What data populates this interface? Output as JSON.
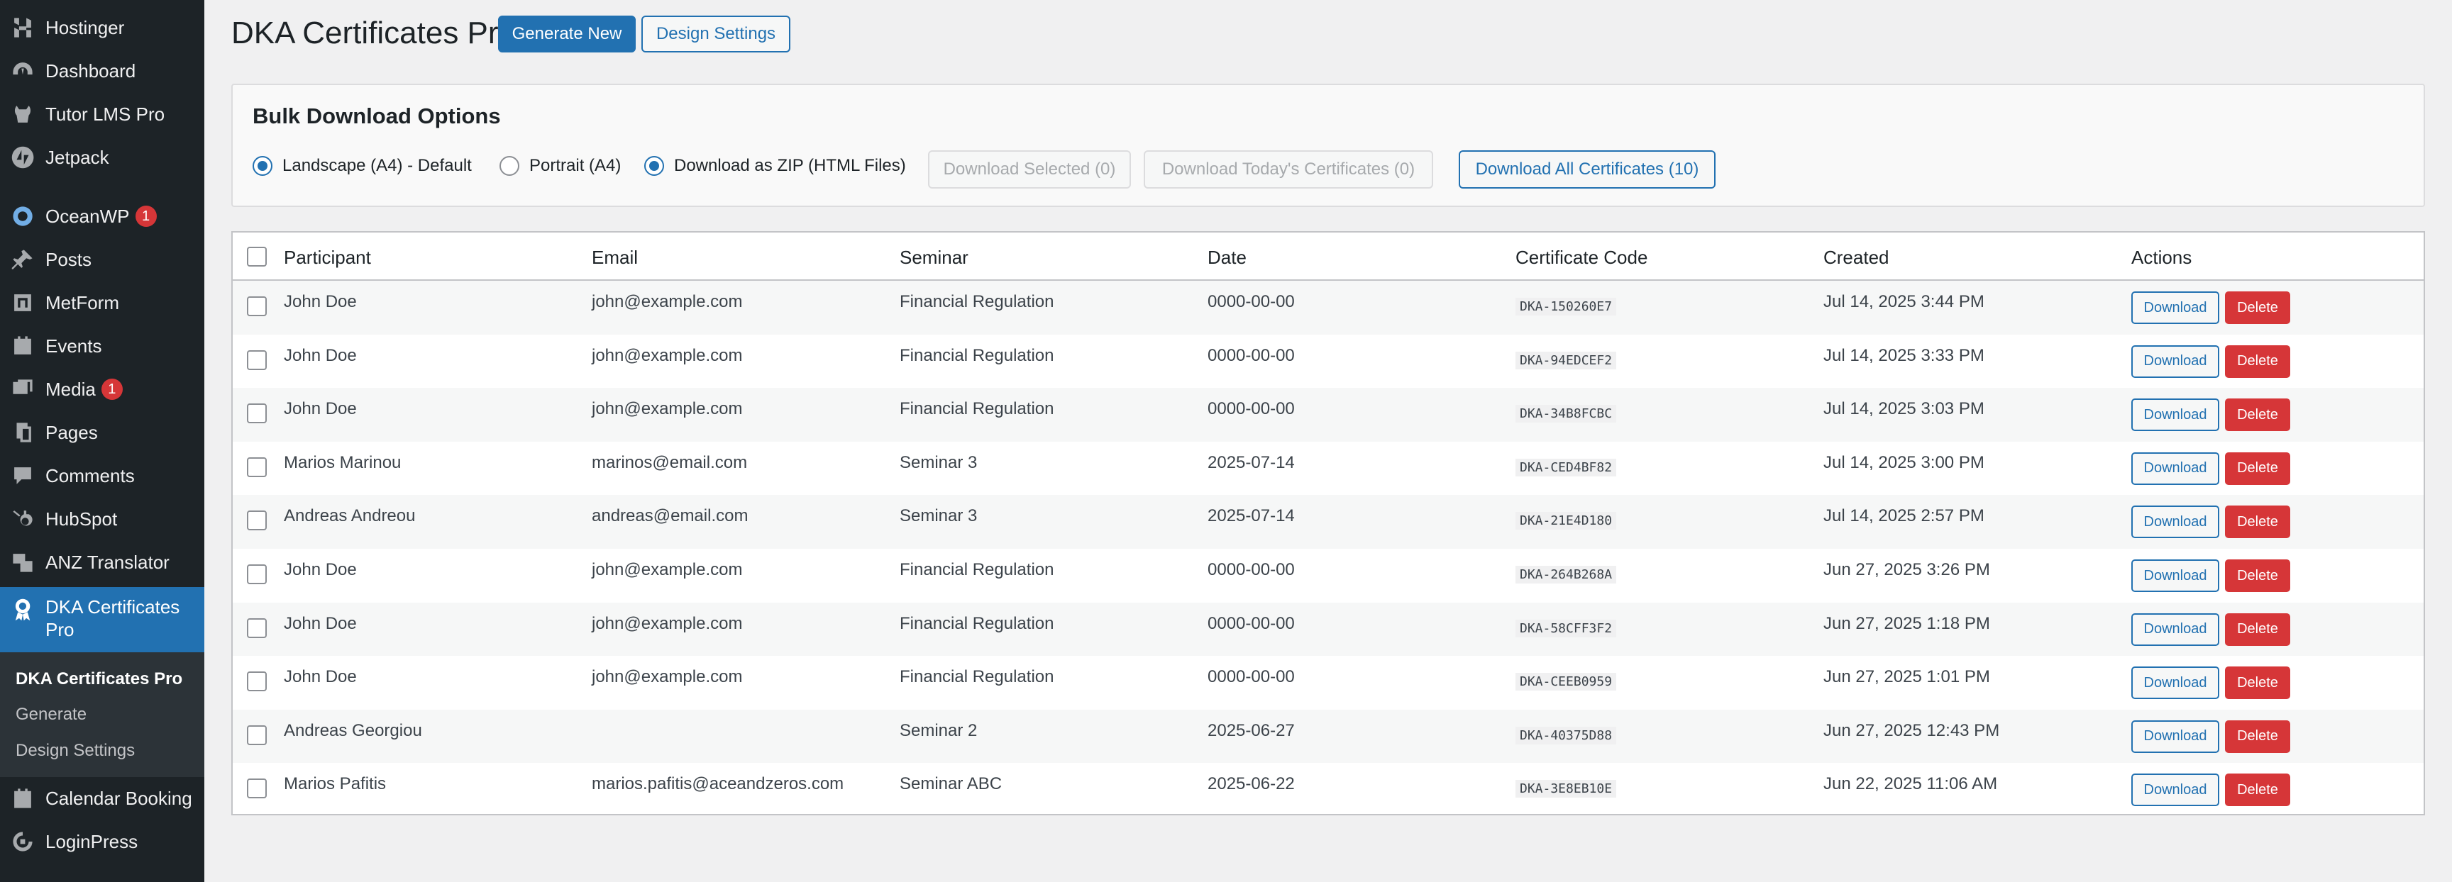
{
  "sidebar": {
    "items": [
      {
        "label": "Hostinger",
        "icon": "hostinger-icon"
      },
      {
        "label": "Dashboard",
        "icon": "dashboard-icon"
      },
      {
        "label": "Tutor LMS Pro",
        "icon": "tutor-icon"
      },
      {
        "label": "Jetpack",
        "icon": "jetpack-icon"
      },
      {
        "label": "OceanWP",
        "icon": "oceanwp-icon",
        "badge": "1"
      },
      {
        "label": "Posts",
        "icon": "pin-icon"
      },
      {
        "label": "MetForm",
        "icon": "metform-icon"
      },
      {
        "label": "Events",
        "icon": "events-icon"
      },
      {
        "label": "Media",
        "icon": "media-icon",
        "badge": "1"
      },
      {
        "label": "Pages",
        "icon": "pages-icon"
      },
      {
        "label": "Comments",
        "icon": "comments-icon"
      },
      {
        "label": "HubSpot",
        "icon": "hubspot-icon"
      },
      {
        "label": "ANZ Translator",
        "icon": "translator-icon"
      },
      {
        "label": "DKA Certificates Pro",
        "icon": "award-icon"
      },
      {
        "label": "Calendar Booking",
        "icon": "calendar-icon"
      },
      {
        "label": "LoginPress",
        "icon": "loginpress-icon"
      }
    ],
    "submenu": [
      "DKA Certificates Pro",
      "Generate",
      "Design Settings"
    ]
  },
  "header": {
    "title": "DKA Certificates Pro",
    "generate_label": "Generate New",
    "design_label": "Design Settings"
  },
  "bulk": {
    "title": "Bulk Download Options",
    "options": [
      "Landscape (A4) - Default",
      "Portrait (A4)",
      "Download as ZIP (HTML Files)"
    ],
    "selected_label": "Download Selected (0)",
    "today_label": "Download Today's Certificates (0)",
    "all_label": "Download All Certificates (10)"
  },
  "table": {
    "columns": [
      "Participant",
      "Email",
      "Seminar",
      "Date",
      "Certificate Code",
      "Created",
      "Actions"
    ],
    "download_label": "Download",
    "delete_label": "Delete",
    "rows": [
      {
        "participant": "John Doe",
        "email": "john@example.com",
        "seminar": "Financial Regulation",
        "date": "0000-00-00",
        "code": "DKA-150260E7",
        "created": "Jul 14, 2025 3:44 PM"
      },
      {
        "participant": "John Doe",
        "email": "john@example.com",
        "seminar": "Financial Regulation",
        "date": "0000-00-00",
        "code": "DKA-94EDCEF2",
        "created": "Jul 14, 2025 3:33 PM"
      },
      {
        "participant": "John Doe",
        "email": "john@example.com",
        "seminar": "Financial Regulation",
        "date": "0000-00-00",
        "code": "DKA-34B8FCBC",
        "created": "Jul 14, 2025 3:03 PM"
      },
      {
        "participant": "Marios Marinou",
        "email": "marinos@email.com",
        "seminar": "Seminar 3",
        "date": "2025-07-14",
        "code": "DKA-CED4BF82",
        "created": "Jul 14, 2025 3:00 PM"
      },
      {
        "participant": "Andreas Andreou",
        "email": "andreas@email.com",
        "seminar": "Seminar 3",
        "date": "2025-07-14",
        "code": "DKA-21E4D180",
        "created": "Jul 14, 2025 2:57 PM"
      },
      {
        "participant": "John Doe",
        "email": "john@example.com",
        "seminar": "Financial Regulation",
        "date": "0000-00-00",
        "code": "DKA-264B268A",
        "created": "Jun 27, 2025 3:26 PM"
      },
      {
        "participant": "John Doe",
        "email": "john@example.com",
        "seminar": "Financial Regulation",
        "date": "0000-00-00",
        "code": "DKA-58CFF3F2",
        "created": "Jun 27, 2025 1:18 PM"
      },
      {
        "participant": "John Doe",
        "email": "john@example.com",
        "seminar": "Financial Regulation",
        "date": "0000-00-00",
        "code": "DKA-CEEB0959",
        "created": "Jun 27, 2025 1:01 PM"
      },
      {
        "participant": "Andreas Georgiou",
        "email": "",
        "seminar": "Seminar 2",
        "date": "2025-06-27",
        "code": "DKA-40375D88",
        "created": "Jun 27, 2025 12:43 PM"
      },
      {
        "participant": "Marios Pafitis",
        "email": "marios.pafitis@aceandzeros.com",
        "seminar": "Seminar ABC",
        "date": "2025-06-22",
        "code": "DKA-3E8EB10E",
        "created": "Jun 22, 2025 11:06 AM"
      }
    ]
  },
  "colors": {
    "sidebar_bg": "#1d2327",
    "accent": "#2271b1",
    "danger": "#d63638"
  }
}
